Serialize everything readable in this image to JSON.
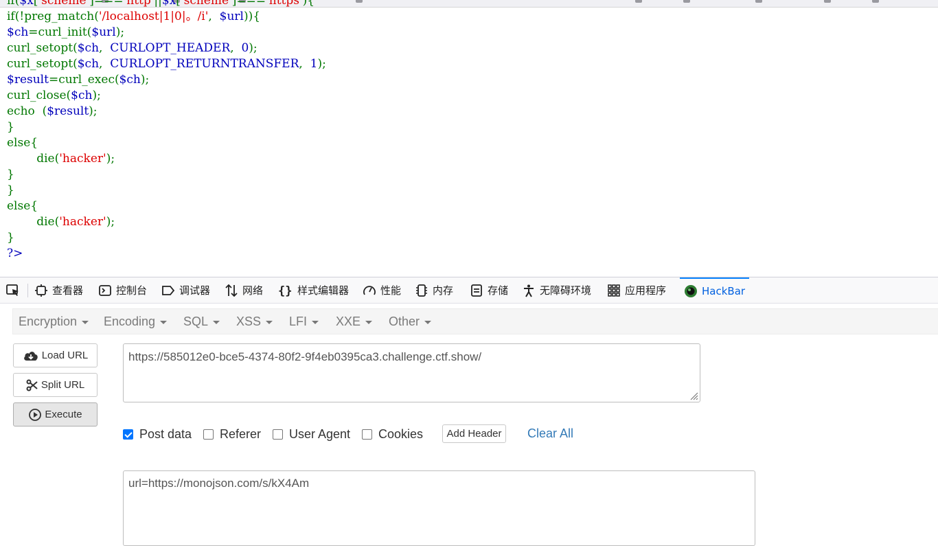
{
  "code_lines": [
    [
      {
        "t": "if(",
        "c": "k"
      },
      {
        "t": "$x",
        "c": "v"
      },
      {
        "t": "['",
        "c": "k"
      },
      {
        "t": "scheme",
        "c": "s"
      },
      {
        "t": "']===",
        "c": "k"
      },
      {
        "t": "'http'",
        "c": "s"
      },
      {
        "t": "||",
        "c": "k"
      },
      {
        "t": "$x",
        "c": "v"
      },
      {
        "t": "['",
        "c": "k"
      },
      {
        "t": "scheme",
        "c": "s"
      },
      {
        "t": "']===",
        "c": "k"
      },
      {
        "t": "'https'",
        "c": "s"
      },
      {
        "t": "){",
        "c": "k"
      }
    ],
    [
      {
        "t": "if(!preg_match(",
        "c": "k"
      },
      {
        "t": "'/localhost|1|0|。/i'",
        "c": "s"
      },
      {
        "t": ",  ",
        "c": "k"
      },
      {
        "t": "$url",
        "c": "v"
      },
      {
        "t": ")){",
        "c": "k"
      }
    ],
    [
      {
        "t": "$ch",
        "c": "v"
      },
      {
        "t": "=curl_init(",
        "c": "k"
      },
      {
        "t": "$url",
        "c": "v"
      },
      {
        "t": ");",
        "c": "k"
      }
    ],
    [
      {
        "t": "curl_setopt(",
        "c": "k"
      },
      {
        "t": "$ch",
        "c": "v"
      },
      {
        "t": ",  ",
        "c": "k"
      },
      {
        "t": "CURLOPT_HEADER",
        "c": "v"
      },
      {
        "t": ",  ",
        "c": "k"
      },
      {
        "t": "0",
        "c": "v"
      },
      {
        "t": ");",
        "c": "k"
      }
    ],
    [
      {
        "t": "curl_setopt(",
        "c": "k"
      },
      {
        "t": "$ch",
        "c": "v"
      },
      {
        "t": ",  ",
        "c": "k"
      },
      {
        "t": "CURLOPT_RETURNTRANSFER",
        "c": "v"
      },
      {
        "t": ",  ",
        "c": "k"
      },
      {
        "t": "1",
        "c": "v"
      },
      {
        "t": ");",
        "c": "k"
      }
    ],
    [
      {
        "t": "$result",
        "c": "v"
      },
      {
        "t": "=curl_exec(",
        "c": "k"
      },
      {
        "t": "$ch",
        "c": "v"
      },
      {
        "t": ");",
        "c": "k"
      }
    ],
    [
      {
        "t": "curl_close(",
        "c": "k"
      },
      {
        "t": "$ch",
        "c": "v"
      },
      {
        "t": ");",
        "c": "k"
      }
    ],
    [
      {
        "t": "echo  (",
        "c": "k"
      },
      {
        "t": "$result",
        "c": "v"
      },
      {
        "t": ");",
        "c": "k"
      }
    ],
    [
      {
        "t": "}",
        "c": "k"
      }
    ],
    [
      {
        "t": "else{",
        "c": "k"
      }
    ],
    [
      {
        "t": "        die(",
        "c": "k"
      },
      {
        "t": "'hacker'",
        "c": "s"
      },
      {
        "t": ");",
        "c": "k"
      }
    ],
    [
      {
        "t": "}",
        "c": "k"
      }
    ],
    [
      {
        "t": "}",
        "c": "k"
      }
    ],
    [
      {
        "t": "else{",
        "c": "k"
      }
    ],
    [
      {
        "t": "        die(",
        "c": "k"
      },
      {
        "t": "'hacker'",
        "c": "s"
      },
      {
        "t": ");",
        "c": "k"
      }
    ],
    [
      {
        "t": "}",
        "c": "k"
      }
    ],
    [
      {
        "t": "?>",
        "c": "v"
      }
    ]
  ],
  "devtools": {
    "tabs": [
      {
        "label": "查看器",
        "icon": "inspector-icon"
      },
      {
        "label": "控制台",
        "icon": "console-icon"
      },
      {
        "label": "调试器",
        "icon": "debugger-icon"
      },
      {
        "label": "网络",
        "icon": "network-icon"
      },
      {
        "label": "样式编辑器",
        "icon": "style-editor-icon"
      },
      {
        "label": "性能",
        "icon": "performance-icon"
      },
      {
        "label": "内存",
        "icon": "memory-icon"
      },
      {
        "label": "存储",
        "icon": "storage-icon"
      },
      {
        "label": "无障碍环境",
        "icon": "accessibility-icon"
      },
      {
        "label": "应用程序",
        "icon": "application-icon"
      },
      {
        "label": "HackBar",
        "icon": "hackbar-icon",
        "active": true
      }
    ]
  },
  "hackbar": {
    "menu": [
      "Encryption",
      "Encoding",
      "SQL",
      "XSS",
      "LFI",
      "XXE",
      "Other"
    ],
    "buttons": {
      "load_url": "Load URL",
      "split_url": "Split URL",
      "execute": "Execute"
    },
    "url_value": "https://585012e0-bce5-4374-80f2-9f4eb0395ca3.challenge.ctf.show/",
    "options": {
      "post_data": {
        "label": "Post data",
        "checked": true
      },
      "referer": {
        "label": "Referer",
        "checked": false
      },
      "user_agent": {
        "label": "User Agent",
        "checked": false
      },
      "cookies": {
        "label": "Cookies",
        "checked": false
      }
    },
    "add_header": "Add Header",
    "clear_all": "Clear All",
    "post_value": "url=https://monojson.com/s/kX4Am"
  },
  "colors": {
    "keyword": "#007700",
    "variable": "#0000bb",
    "string": "#dd0000",
    "link": "#337ab7",
    "active_tab": "#0060df",
    "checkbox": "#0075ff"
  }
}
